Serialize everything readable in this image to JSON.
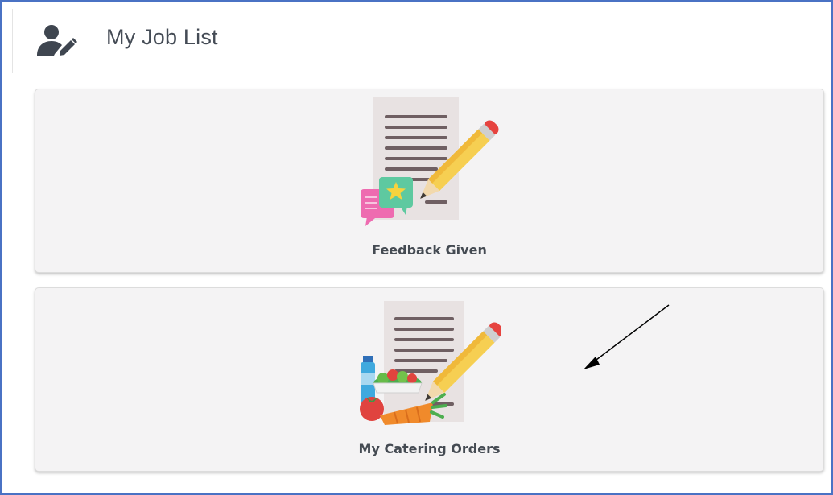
{
  "header": {
    "title": "My Job List",
    "icon": "user-edit-icon"
  },
  "cards": [
    {
      "label": "Feedback Given",
      "icon": "feedback-document-icon"
    },
    {
      "label": "My Catering Orders",
      "icon": "catering-orders-icon"
    }
  ],
  "annotation": {
    "icon": "pointer-arrow"
  },
  "colors": {
    "frame_border": "#4a72c4",
    "card_background": "#f4f3f4",
    "title_text": "#444b55",
    "pencil_yellow": "#f6cf52",
    "pencil_red": "#e6433f",
    "bubble_pink": "#ee6bb0",
    "bubble_green": "#5ec9a0"
  }
}
